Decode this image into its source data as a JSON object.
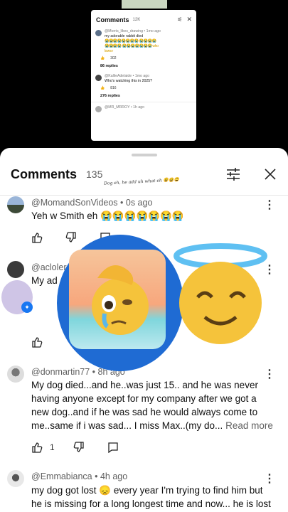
{
  "tape_text": "",
  "mini": {
    "title": "Comments",
    "count": "12K",
    "c1_handle": "@Morris_likes_drawing • 1mo ago",
    "c1_text": "my adorable rabbit died",
    "c1_emojis": "😭😭😭😭😭😭😭😭 😭😭😭😭😭😭😭😭 😭😭😭😭😭😭😭 who loves r",
    "c1_likes": "302",
    "c1_replies": "86 replies",
    "c2_handle": "@KallieAdelaide • 1mo ago",
    "c2_text": "Who's watching this in 2025?",
    "c2_likes": "816",
    "c2_replies": "276 replies",
    "c3_handle": "@MR_MRROY • 1h ago"
  },
  "sheet": {
    "title": "Comments",
    "count": "135",
    "handwritten": "Dog eh, he add uh what eh 😩😩😩"
  },
  "comments": [
    {
      "handle": "@MomandSonVideos • 0s ago",
      "text": "Yeh w Smith eh 😭😭😭😭😭😭😭"
    },
    {
      "handle": "@acloler",
      "text": "My ad"
    },
    {
      "handle": "@donmartin77 • 8h ago",
      "text": "My dog died...and he..was just 15.. and he was never having anyone except for my company after we got a new dog..and if he was sad he would always come to me..same if i was sad... I miss Max..(my do...",
      "more": "Read more",
      "likes": "1"
    },
    {
      "handle": "@Emmabianca • 4h ago",
      "text": "my dog got lost 😞 every year I'm trying to find him but he is missing for a long longest time and now... he is lost"
    }
  ],
  "colors": {
    "sheet_bg": "#ffffff",
    "overlay_blue": "#1f6bd3",
    "muted": "#606060"
  }
}
